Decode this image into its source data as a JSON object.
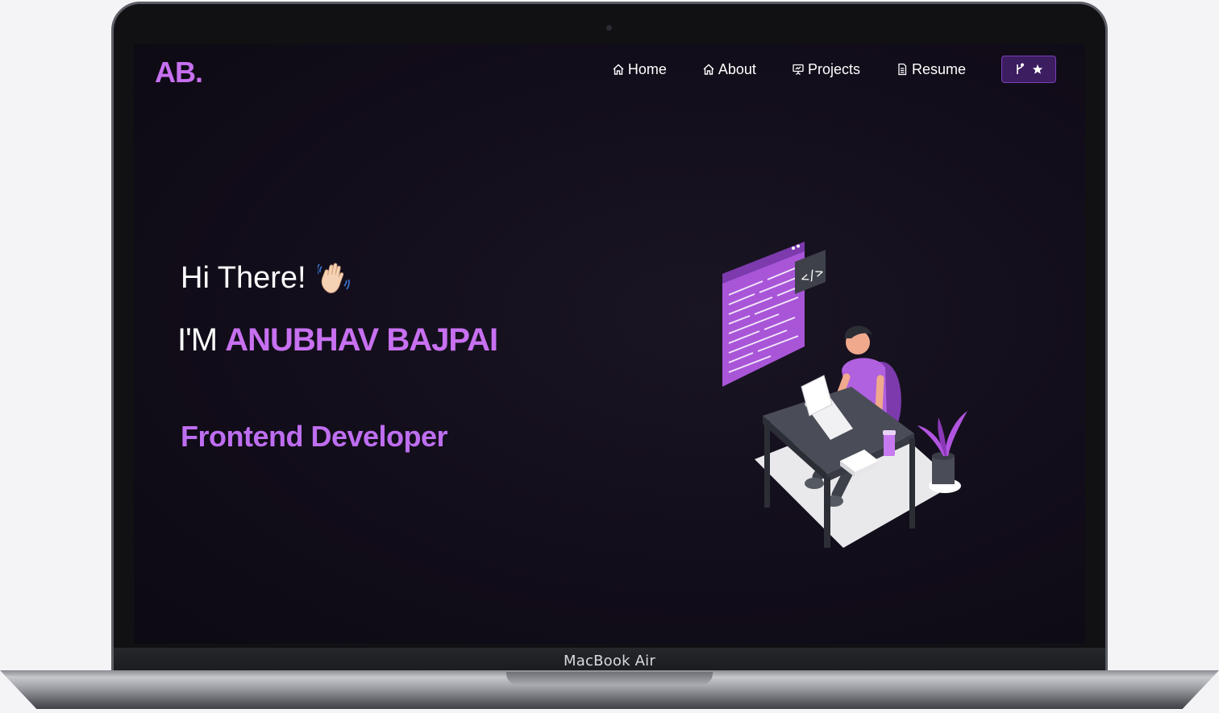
{
  "nav": {
    "logo": "AB.",
    "items": [
      {
        "label": "Home",
        "icon": "home-icon"
      },
      {
        "label": "About",
        "icon": "home-icon"
      },
      {
        "label": "Projects",
        "icon": "presentation-icon"
      },
      {
        "label": "Resume",
        "icon": "document-icon"
      }
    ],
    "fork_button_icons": [
      "git-fork-icon",
      "star-icon"
    ]
  },
  "hero": {
    "greeting": "Hi There!",
    "intro_prefix": "I'M",
    "name": "ANUBHAV BAJPAI",
    "role": "Frontend Developer"
  },
  "device": {
    "label": "MacBook Air"
  },
  "colors": {
    "accent": "#c770f0",
    "background": "#120d1a",
    "button_bg": "#3c1d60"
  }
}
